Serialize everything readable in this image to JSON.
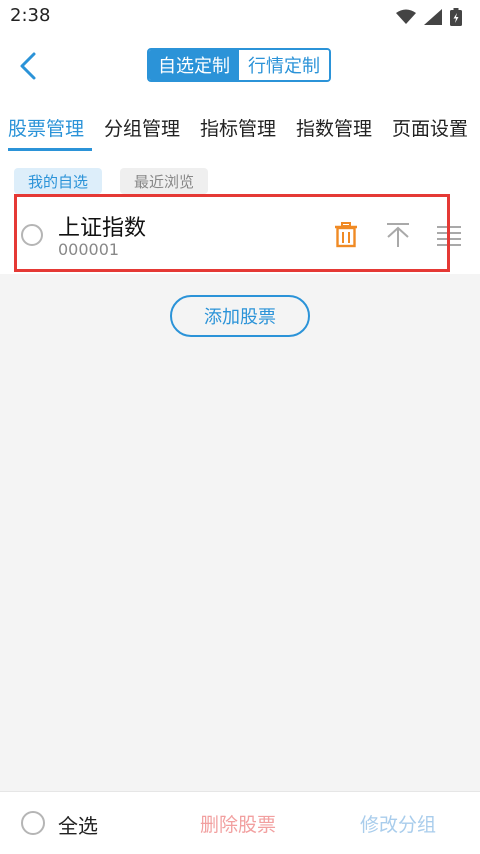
{
  "status_bar": {
    "time": "2:38",
    "icons": [
      "wifi-icon",
      "signal-icon",
      "battery-icon"
    ]
  },
  "header": {
    "segments": [
      {
        "label": "自选定制",
        "active": true
      },
      {
        "label": "行情定制",
        "active": false
      }
    ]
  },
  "tabs": [
    {
      "label": "股票管理",
      "active": true
    },
    {
      "label": "分组管理",
      "active": false
    },
    {
      "label": "指标管理",
      "active": false
    },
    {
      "label": "指数管理",
      "active": false
    },
    {
      "label": "页面设置",
      "active": false
    }
  ],
  "chips": [
    {
      "label": "我的自选",
      "active": true
    },
    {
      "label": "最近浏览",
      "active": false
    }
  ],
  "stocks": [
    {
      "name": "上证指数",
      "code": "000001"
    }
  ],
  "add_button": "添加股票",
  "bottom": {
    "select_all": "全选",
    "delete": "删除股票",
    "modify_group": "修改分组"
  },
  "colors": {
    "accent": "#2b93d8",
    "delete_icon": "#f08a24",
    "highlight": "#e53935",
    "delete_disabled": "#f2a0a0",
    "modify_disabled": "#a9cdec"
  }
}
